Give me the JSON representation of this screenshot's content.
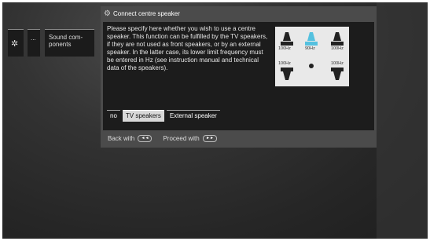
{
  "menu": {
    "items": [
      {
        "icon": "gear-icon",
        "label": ""
      },
      {
        "label": "..."
      },
      {
        "label": "Sound com-\nponents"
      }
    ]
  },
  "dialog": {
    "title": "Connect centre speaker",
    "title_icon": "speaker-settings-icon",
    "description": "Please specify here whether you wish to use a centre speaker. This function can be fulfilled by the TV speakers, if they are not used as front speakers, or by an external speaker. In the latter case, its lower limit frequency must be entered in Hz (see instruction manual and technical data of the speakers).",
    "speaker_config": {
      "front_left_hz": "100Hz",
      "centre_hz": "90Hz",
      "front_right_hz": "100Hz",
      "rear_left_hz": "100Hz",
      "rear_right_hz": "100Hz",
      "highlight_color": "#55c1df"
    },
    "options": [
      "no",
      "TV speakers",
      "External speaker"
    ],
    "selected_option": "TV speakers",
    "footer": {
      "back_label": "Back with",
      "back_key": "◄◄",
      "proceed_label": "Proceed with",
      "proceed_key": "►►"
    }
  }
}
